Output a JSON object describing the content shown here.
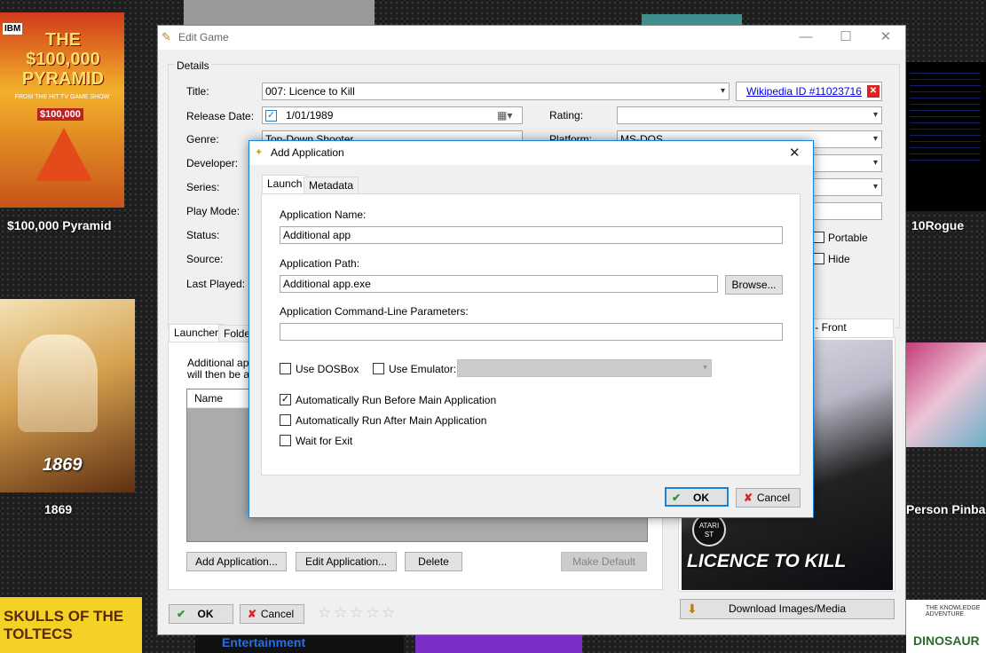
{
  "background": {
    "tiles": [
      {
        "title": "$100,000 Pyramid"
      },
      {
        "title": "10Rogue"
      },
      {
        "title": "1869"
      },
      {
        "title": "Person Pinbal"
      }
    ],
    "covers": {
      "pyramid_top": "THE $100,000 PYRAMID",
      "pyramid_sub": "FROM THE HIT TV GAME SHOW",
      "pyramid_amount": "$100,000",
      "pyramid_brand": "IBM",
      "ship_title": "1869",
      "skulls_title": "SKULLS OF THE TOLTECS",
      "entertainment": "Entertainment",
      "dinosaur": "DINOSAUR",
      "knowledge": "THE KNOWLEDGE ADVENTURE"
    }
  },
  "edit_game": {
    "title": "Edit Game",
    "details_label": "Details",
    "labels": {
      "title": "Title:",
      "release_date": "Release Date:",
      "genre": "Genre:",
      "developer": "Developer:",
      "series": "Series:",
      "play_mode": "Play Mode:",
      "status": "Status:",
      "source": "Source:",
      "last_played": "Last Played:",
      "rating": "Rating:",
      "platform": "Platform:"
    },
    "values": {
      "title": "007: Licence to Kill",
      "release_date": "1/01/1989",
      "genre": "Top-Down Shooter",
      "platform": "MS-DOS",
      "rating": ""
    },
    "wikipedia_link": "Wikipedia ID #11023716",
    "checkboxes": {
      "portable": "Portable",
      "hide": "Hide"
    },
    "tabs": {
      "launcher": "Launcher",
      "folders": "Folder"
    },
    "apps_text_1": "Additional appl",
    "apps_text_2": "will then be av",
    "apps_col_name": "Name",
    "image_tab": "x - Front",
    "cover_title": "LICENCE TO KILL",
    "cover_badge": "ATARI ST",
    "buttons": {
      "add_app": "Add Application...",
      "edit_app": "Edit Application...",
      "delete": "Delete",
      "make_default": "Make Default",
      "ok": "OK",
      "cancel": "Cancel",
      "download": "Download Images/Media"
    },
    "stars": [
      "☆",
      "☆",
      "☆",
      "☆",
      "☆"
    ]
  },
  "add_app": {
    "title": "Add Application",
    "tabs": {
      "launch": "Launch",
      "metadata": "Metadata"
    },
    "name_label": "Application Name:",
    "name_value": "Additional app",
    "path_label": "Application Path:",
    "path_value": "Additional app.exe",
    "browse": "Browse...",
    "params_label": "Application Command-Line Parameters:",
    "params_value": "",
    "use_dosbox": "Use DOSBox",
    "use_emulator": "Use Emulator:",
    "auto_before": "Automatically Run Before Main Application",
    "auto_after": "Automatically Run After Main Application",
    "wait_exit": "Wait for Exit",
    "ok": "OK",
    "cancel": "Cancel",
    "checked": {
      "use_dosbox": false,
      "use_emulator": false,
      "auto_before": true,
      "auto_after": false,
      "wait_exit": false
    }
  },
  "colors": {
    "accent": "#1883d7",
    "link": "#0000ee",
    "ok_green": "#2a9a2a",
    "cancel_red": "#d22222"
  }
}
